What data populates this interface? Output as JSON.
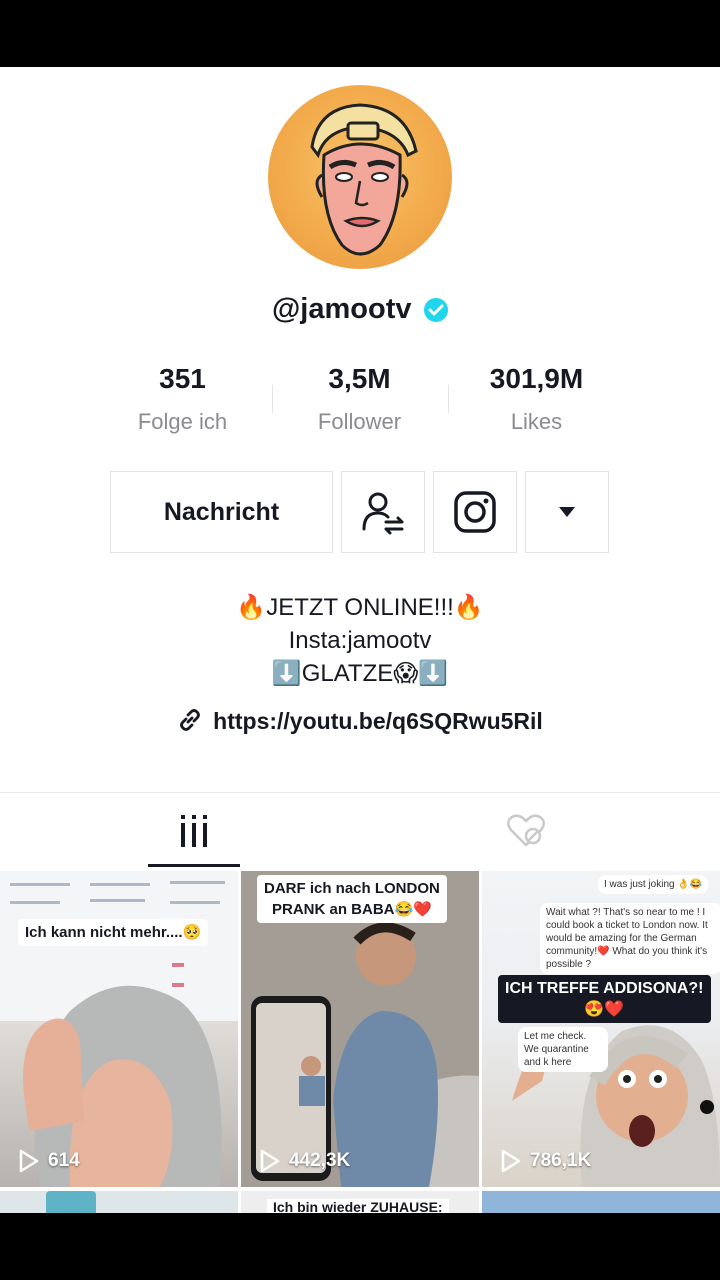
{
  "profile": {
    "username": "@jamootv",
    "verified": true,
    "stats": [
      {
        "value": "351",
        "label": "Folge ich"
      },
      {
        "value": "3,5M",
        "label": "Follower"
      },
      {
        "value": "301,9M",
        "label": "Likes"
      }
    ],
    "message_button": "Nachricht",
    "bio": {
      "line1_text": "JETZT ONLINE!!!",
      "line1_emoji": "🔥",
      "line2": "Insta:jamootv",
      "line3_text": "GLATZE",
      "line3_arrow": "⬇️",
      "line3_emoji": "😱",
      "link": "https://youtu.be/q6SQRwu5Ril"
    }
  },
  "icons": {
    "verified": "verified-check-icon",
    "follow_suggestions": "user-swap-icon",
    "instagram": "instagram-icon",
    "dropdown": "triangle-down-icon",
    "link": "link-icon",
    "videos_tab": "grid-bars-icon",
    "liked_tab": "heart-hidden-icon",
    "play": "play-outline-icon"
  },
  "colors": {
    "text_primary": "#161823",
    "text_secondary": "#8a8b91",
    "verified": "#20d5ec",
    "border": "#e3e3e4"
  },
  "videos": [
    {
      "caption": "Ich kann nicht mehr....🥺",
      "views": "614"
    },
    {
      "caption_line1": "DARF ich nach LONDON",
      "caption_line2": "PRANK an BABA😂❤️",
      "views": "442,3K"
    },
    {
      "caption": "ICH TREFFE ADDISONA?!",
      "caption_emoji": "😍❤️",
      "views": "786,1K",
      "chat": [
        "I was just joking 👌😂",
        "Wait what ?! That's so near to me ! I could book a ticket to London now. It would be amazing for the German community!❤️ What do you think it's possible ?",
        "Let me check. We quarantine and k here"
      ]
    }
  ],
  "row2_captions": [
    "",
    "Ich bin wieder ZUHAUSE:",
    ""
  ]
}
